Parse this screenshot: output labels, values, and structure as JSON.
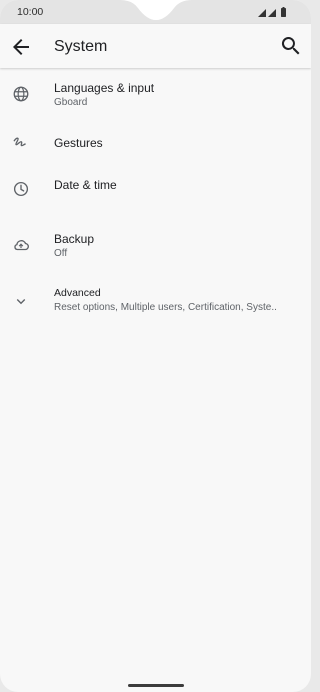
{
  "status_bar": {
    "time": "10:00"
  },
  "app_bar": {
    "title": "System",
    "back_icon": "arrow-back-icon",
    "search_icon": "search-icon"
  },
  "items": [
    {
      "icon": "globe-icon",
      "label": "Languages & input",
      "sub": "Gboard"
    },
    {
      "icon": "gesture-icon",
      "label": "Gestures",
      "sub": ""
    },
    {
      "icon": "clock-icon",
      "label": "Date & time",
      "sub": ""
    },
    {
      "icon": "cloud-upload-icon",
      "label": "Backup",
      "sub": "Off"
    },
    {
      "icon": "chevron-down-icon",
      "label": "Advanced",
      "sub": "Reset options, Multiple users, Certification, Syste.."
    }
  ]
}
